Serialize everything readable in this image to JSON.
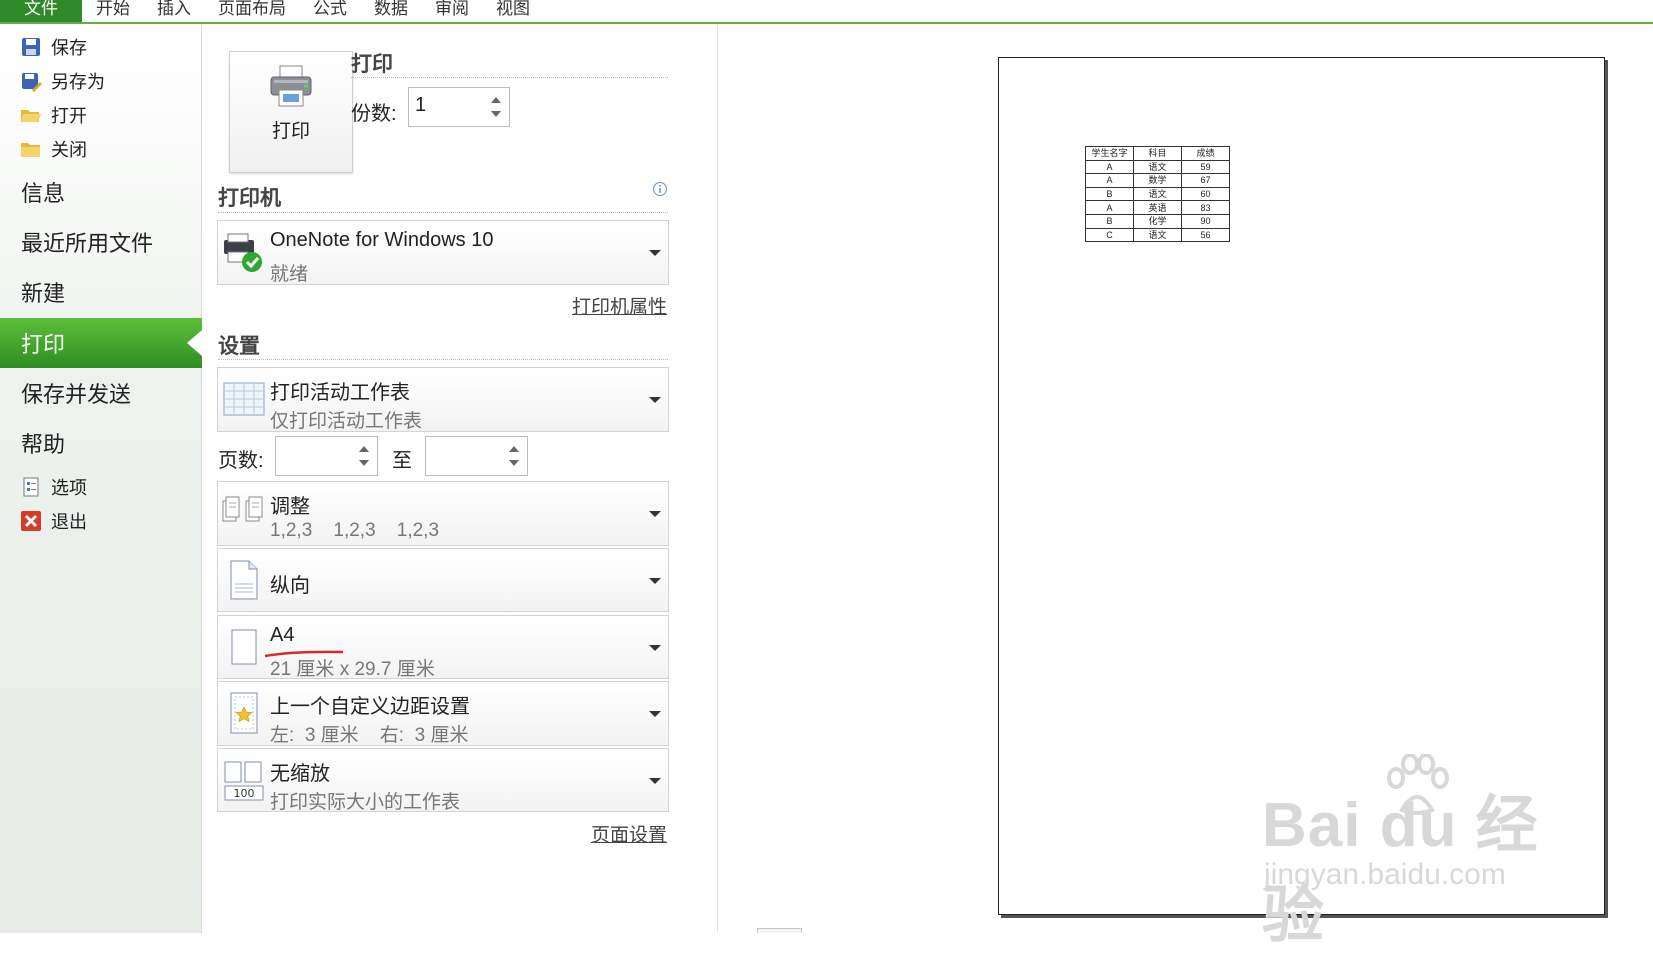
{
  "ribbon": {
    "tabs": [
      "文件",
      "开始",
      "插入",
      "页面布局",
      "公式",
      "数据",
      "审阅",
      "视图"
    ]
  },
  "nav": {
    "small_top": [
      "保存",
      "另存为",
      "打开",
      "关闭"
    ],
    "big": [
      "信息",
      "最近所用文件",
      "新建",
      "打印",
      "保存并发送",
      "帮助"
    ],
    "active": "打印",
    "small_bottom": [
      "选项",
      "退出"
    ]
  },
  "print": {
    "button_label": "打印",
    "section_title": "打印",
    "copies_label": "份数:",
    "copies_value": "1"
  },
  "printer": {
    "section_title": "打印机",
    "name": "OneNote for Windows 10",
    "status": "就绪",
    "properties_link": "打印机属性"
  },
  "settings": {
    "section_title": "设置",
    "what_title": "打印活动工作表",
    "what_desc": "仅打印活动工作表",
    "pages_label": "页数:",
    "pages_to": "至",
    "pages_from_value": "",
    "pages_to_value": "",
    "collate_title": "调整",
    "collate_desc": "1,2,3    1,2,3    1,2,3",
    "orientation": "纵向",
    "paper_title": "A4",
    "paper_desc": "21 厘米 x 29.7 厘米",
    "margin_title": "上一个自定义边距设置",
    "margin_desc": "左:  3 厘米    右:  3 厘米",
    "scale_title": "无缩放",
    "scale_desc": "打印实际大小的工作表",
    "page_setup_link": "页面设置"
  },
  "preview": {
    "table_header": [
      "学生名字",
      "科目",
      "成绩"
    ],
    "table_rows": [
      [
        "A",
        "语文",
        "59"
      ],
      [
        "A",
        "数学",
        "67"
      ],
      [
        "B",
        "语文",
        "60"
      ],
      [
        "A",
        "英语",
        "83"
      ],
      [
        "B",
        "化学",
        "90"
      ],
      [
        "C",
        "语文",
        "56"
      ]
    ]
  },
  "watermark": {
    "brand": "Bai du 经验",
    "url": "jingyan.baidu.com"
  },
  "colors": {
    "accent_green": "#2f8a2a",
    "active_nav": "#4aac33",
    "underline_red": "#d62b2b"
  }
}
